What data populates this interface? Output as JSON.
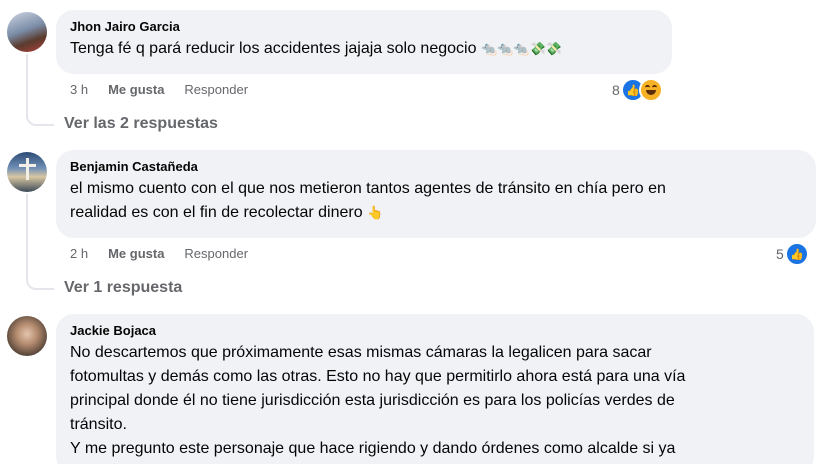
{
  "comments": [
    {
      "author": "Jhon Jairo Garcia",
      "text": "Tenga fé q pará reducir los accidentes jajaja solo negocio",
      "emojis": "🐀🐀🐀💸💸",
      "time": "3 h",
      "like_label": "Me gusta",
      "reply_label": "Responder",
      "reaction_count": "8",
      "reactions": [
        "like-icon",
        "haha-icon"
      ],
      "replies_link": "Ver las 2 respuestas"
    },
    {
      "author": "Benjamin Castañeda",
      "text": "el mismo cuento con el que nos metieron tantos agentes de tránsito en chía pero en\nrealidad es con el fin de recolectar dinero",
      "emojis": "👆",
      "time": "2 h",
      "like_label": "Me gusta",
      "reply_label": "Responder",
      "reaction_count": "5",
      "reactions": [
        "like-icon"
      ],
      "replies_link": "Ver 1 respuesta"
    },
    {
      "author": "Jackie Bojaca",
      "text": "No descartemos que próximamente esas mismas cámaras la legalicen para sacar\nfotomultas y demás como las otras. Esto no hay que permitirlo ahora está para una vía\nprincipal donde él no tiene jurisdicción esta jurisdicción es para los policías verdes de\ntránsito.\nY me pregunto este personaje que hace rigiendo y dando órdenes como alcalde si ya"
    }
  ],
  "colors": {
    "bubble": "#f0f2f5",
    "meta_text": "#65676b",
    "like_blue": "#1b74e4",
    "haha_yellow": "#f7b125"
  }
}
